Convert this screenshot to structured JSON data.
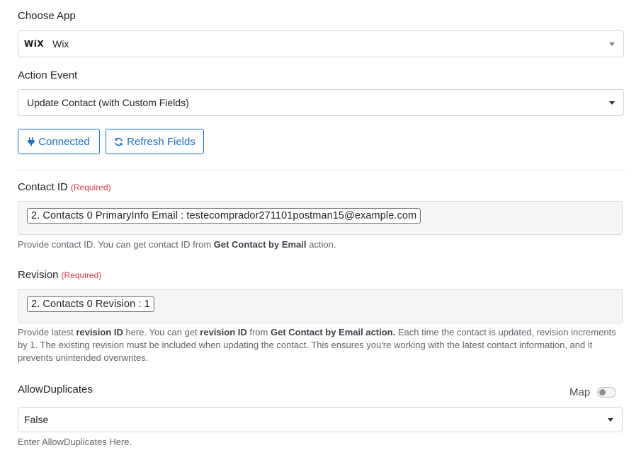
{
  "choose_app": {
    "label": "Choose App",
    "selected_logo": "WiX",
    "selected_value": "Wix"
  },
  "action_event": {
    "label": "Action Event",
    "selected_value": "Update Contact (with Custom Fields)"
  },
  "buttons": {
    "connected_label": "Connected",
    "connected_icon": "plug-icon",
    "refresh_label": "Refresh Fields",
    "refresh_icon": "refresh-icon"
  },
  "contact_id": {
    "label": "Contact ID",
    "required_text": "(Required)",
    "value": "2. Contacts 0 PrimaryInfo Email : testecomprador271101postman15@example.com",
    "help_1": "Provide contact ID. You can get contact ID from ",
    "help_bold": "Get Contact by Email",
    "help_2": " action."
  },
  "revision": {
    "label": "Revision",
    "required_text": "(Required)",
    "value": "2. Contacts 0 Revision : 1",
    "help_1": "Provide latest ",
    "help_bold_1": "revision ID",
    "help_2": " here. You can get ",
    "help_bold_2": "revision ID",
    "help_3": " from ",
    "help_bold_3": "Get Contact by Email action.",
    "help_4": " Each time the contact is updated, revision increments by 1. The existing revision must be included when updating the contact. This ensures you're working with the latest contact information, and it prevents unintended overwrites."
  },
  "allow_duplicates": {
    "label": "AllowDuplicates",
    "map_label": "Map",
    "map_enabled": false,
    "selected_value": "False",
    "help": "Enter AllowDuplicates Here."
  }
}
